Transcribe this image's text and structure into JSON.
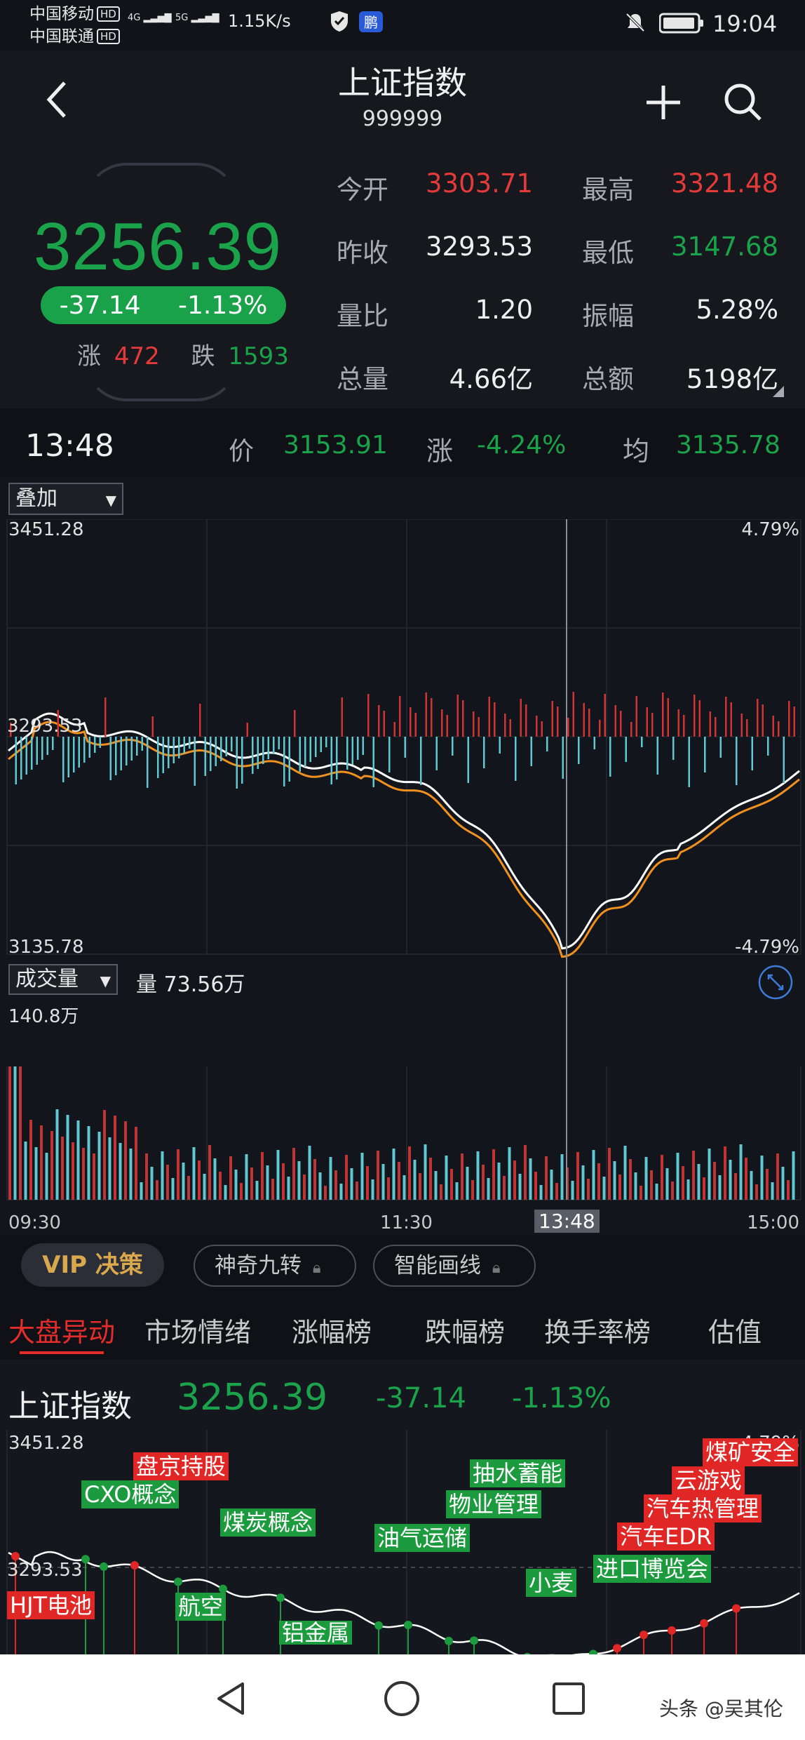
{
  "status_bar": {
    "carrier1": "中国移动",
    "carrier2": "中国联通",
    "hd": "HD",
    "net1": "4G",
    "net2": "5G",
    "speed": "1.15K/s",
    "time": "19:04"
  },
  "header": {
    "title": "上证指数",
    "code": "999999"
  },
  "quote": {
    "price": "3256.39",
    "change": "-37.14",
    "change_pct": "-1.13%",
    "rise_label": "涨",
    "rise_count": "472",
    "fall_label": "跌",
    "fall_count": "1593",
    "stats": [
      {
        "label": "今开",
        "value": "3303.71"
      },
      {
        "label": "最高",
        "value": "3321.48"
      },
      {
        "label": "昨收",
        "value": "3293.53"
      },
      {
        "label": "最低",
        "value": "3147.68"
      },
      {
        "label": "量比",
        "value": "1.20"
      },
      {
        "label": "振幅",
        "value": "5.28%"
      },
      {
        "label": "总量",
        "value": "4.66亿"
      },
      {
        "label": "总额",
        "value": "5198亿"
      }
    ]
  },
  "cursor": {
    "time": "13:48",
    "price_label": "价",
    "price": "3153.91",
    "chg_label": "涨",
    "chg": "-4.24%",
    "avg_label": "均",
    "avg": "3135.78"
  },
  "chart": {
    "overlay_label": "叠加",
    "y_top": "3451.28",
    "y_mid": "3293.53",
    "y_bottom": "3135.78",
    "pct_top": "4.79%",
    "pct_bottom": "-4.79%",
    "volume_label": "成交量",
    "volume_text": "量 73.56万",
    "vol_max": "140.8万",
    "x_start": "09:30",
    "x_mid": "11:30",
    "x_cursor": "13:48",
    "x_end": "15:00"
  },
  "vip": {
    "vip_label": "VIP 决策",
    "btn1": "神奇九转",
    "btn2": "智能画线"
  },
  "tabs": [
    "大盘异动",
    "市场情绪",
    "涨幅榜",
    "跌幅榜",
    "换手率榜",
    "估值"
  ],
  "mini": {
    "name": "上证指数",
    "price": "3256.39",
    "change": "-37.14",
    "change_pct": "-1.13%",
    "y_top": "3451.28",
    "y_mid": "3293.53",
    "pct_top": "4.79%",
    "tags": [
      {
        "text": "盘京持股",
        "color": "r"
      },
      {
        "text": "CXO概念",
        "color": "g"
      },
      {
        "text": "煤炭概念",
        "color": "g"
      },
      {
        "text": "HJT电池",
        "color": "r"
      },
      {
        "text": "航空",
        "color": "g"
      },
      {
        "text": "铝金属",
        "color": "g"
      },
      {
        "text": "油气运储",
        "color": "g"
      },
      {
        "text": "抽水蓄能",
        "color": "g"
      },
      {
        "text": "物业管理",
        "color": "g"
      },
      {
        "text": "小麦",
        "color": "g"
      },
      {
        "text": "进口博览会",
        "color": "g"
      },
      {
        "text": "汽车EDR",
        "color": "r"
      },
      {
        "text": "汽车热管理",
        "color": "r"
      },
      {
        "text": "云游戏",
        "color": "r"
      },
      {
        "text": "煤矿安全",
        "color": "r"
      }
    ]
  },
  "watermark": "头条 @吴其伦",
  "colors": {
    "up": "#e53a3a",
    "down": "#1aa34a",
    "price_line": "#ffffff",
    "avg_line": "#f0901e"
  }
}
